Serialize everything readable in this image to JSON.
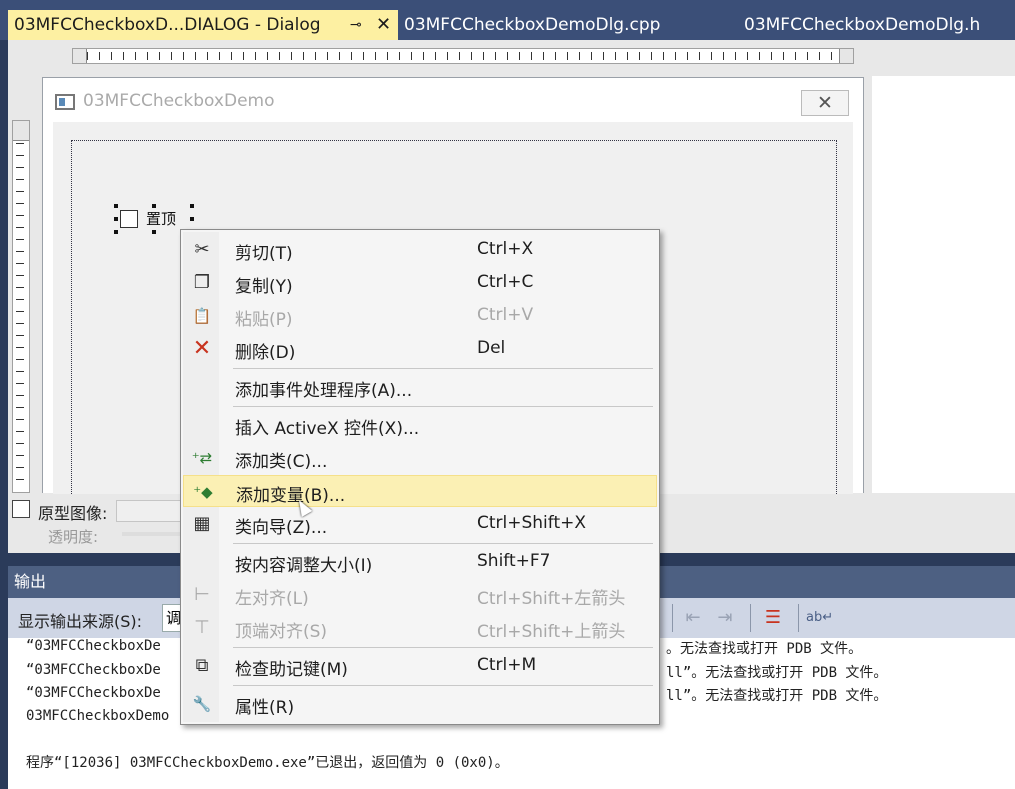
{
  "tabs": [
    {
      "label": "03MFCCheckboxD...DIALOG - Dialog",
      "active": true
    },
    {
      "label": "03MFCCheckboxDemoDlg.cpp",
      "active": false
    },
    {
      "label": "03MFCCheckboxDemoDlg.h",
      "active": false
    }
  ],
  "tab_pin_icon": "⊸",
  "tab_close_icon": "✕",
  "dialog": {
    "title": "03MFCCheckboxDemo",
    "close_glyph": "✕",
    "checkbox_label": "置顶"
  },
  "designer_bottom": {
    "proto_label": "原型图像:",
    "opacity_label": "透明度:"
  },
  "output": {
    "header": "输出",
    "source_label": "显示输出来源(S):",
    "source_value": "调",
    "lines": [
      "“03MFCCheckboxDe",
      "“03MFCCheckboxDe",
      "“03MFCCheckboxDe",
      "03MFCCheckboxDemo",
      "",
      "程序“[12036] 03MFCCheckboxDemo.exe”已退出，返回值为 0 (0x0)。"
    ],
    "line_tails": [
      "。无法查找或打开 PDB 文件。",
      "ll”。无法查找或打开 PDB 文件。",
      "ll”。无法查找或打开 PDB 文件。"
    ]
  },
  "context_menu": {
    "items": [
      {
        "icon": "scissors-icon",
        "glyph": "✂",
        "label": "剪切(T)",
        "shortcut": "Ctrl+X",
        "disabled": false
      },
      {
        "icon": "copy-icon",
        "glyph": "❐",
        "label": "复制(Y)",
        "shortcut": "Ctrl+C",
        "disabled": false
      },
      {
        "icon": "paste-icon",
        "glyph": "📋",
        "label": "粘贴(P)",
        "shortcut": "Ctrl+V",
        "disabled": true
      },
      {
        "icon": "delete-icon",
        "glyph": "✕",
        "label": "删除(D)",
        "shortcut": "Del",
        "disabled": false
      },
      {
        "icon": "",
        "glyph": "",
        "label": "添加事件处理程序(A)...",
        "shortcut": "",
        "disabled": false
      },
      {
        "icon": "",
        "glyph": "",
        "label": "插入 ActiveX 控件(X)...",
        "shortcut": "",
        "disabled": false
      },
      {
        "icon": "add-class-icon",
        "glyph": "⁺⇄",
        "label": "添加类(C)...",
        "shortcut": "",
        "disabled": false
      },
      {
        "icon": "add-variable-icon",
        "glyph": "⁺◆",
        "label": "添加变量(B)...",
        "shortcut": "",
        "disabled": false,
        "hover": true
      },
      {
        "icon": "class-wizard-icon",
        "glyph": "▦",
        "label": "类向导(Z)...",
        "shortcut": "Ctrl+Shift+X",
        "disabled": false
      },
      {
        "icon": "",
        "glyph": "",
        "label": "按内容调整大小(I)",
        "shortcut": "Shift+F7",
        "disabled": false
      },
      {
        "icon": "align-left-icon",
        "glyph": "⊢",
        "label": "左对齐(L)",
        "shortcut": "Ctrl+Shift+左箭头",
        "disabled": true
      },
      {
        "icon": "align-top-icon",
        "glyph": "⊤",
        "label": "顶端对齐(S)",
        "shortcut": "Ctrl+Shift+上箭头",
        "disabled": true
      },
      {
        "icon": "check-mnemonics-icon",
        "glyph": "⧉",
        "label": "检查助记键(M)",
        "shortcut": "Ctrl+M",
        "disabled": false
      },
      {
        "icon": "wrench-icon",
        "glyph": "🔧",
        "label": "属性(R)",
        "shortcut": "",
        "disabled": false
      }
    ]
  },
  "colors": {
    "ide_background": "#2b3b5a",
    "active_tab": "#fdf0a2",
    "menu_hover": "#fbf0b4",
    "delete_icon": "#c8331e"
  }
}
